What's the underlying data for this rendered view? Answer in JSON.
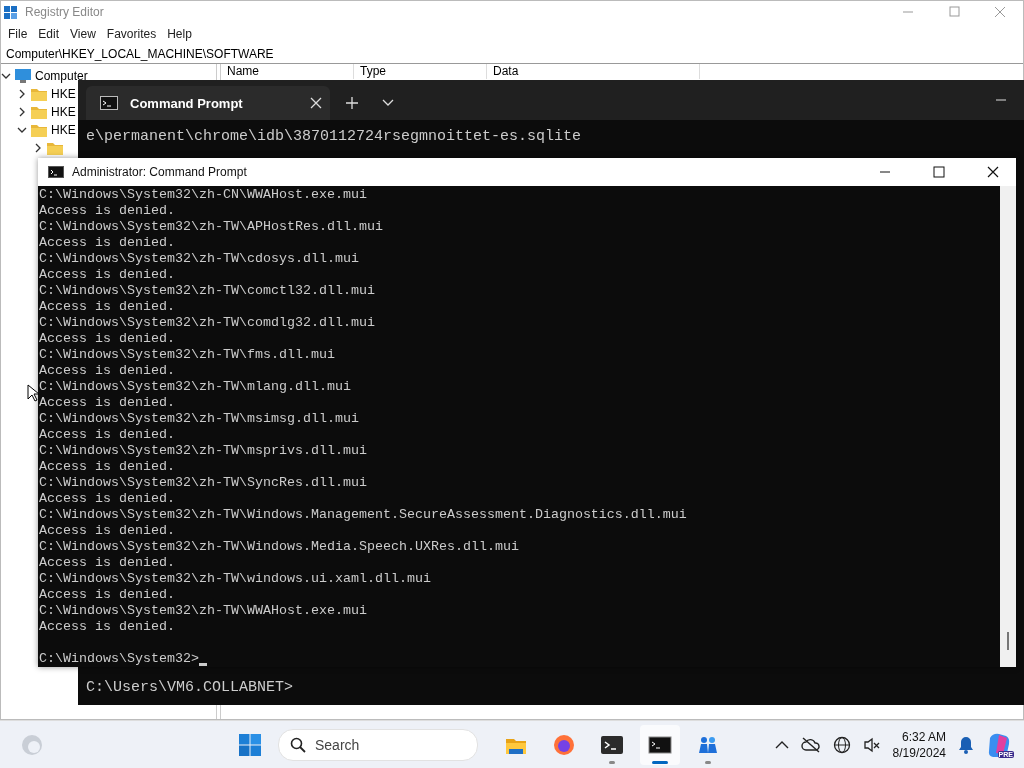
{
  "registry_editor": {
    "title": "Registry Editor",
    "menu": [
      "File",
      "Edit",
      "View",
      "Favorites",
      "Help"
    ],
    "address": "Computer\\HKEY_LOCAL_MACHINE\\SOFTWARE",
    "tree": [
      {
        "label": "Computer",
        "expanded": true,
        "children": [
          {
            "label": "HKE",
            "expanded": false
          },
          {
            "label": "HKE",
            "expanded": false
          },
          {
            "label": "HKE",
            "expanded": true,
            "children": [
              {
                "expanded": false
              }
            ]
          }
        ]
      }
    ],
    "columns": [
      "Name",
      "Type",
      "Data"
    ]
  },
  "terminal": {
    "tabs": [
      {
        "label": "Command Prompt",
        "selected": true
      }
    ],
    "lines": [
      "e\\permanent\\chrome\\idb\\3870112724rsegmnoittet-es.sqlite"
    ],
    "prompt": "C:\\Users\\VM6.COLLABNET>"
  },
  "admin_prompt": {
    "title": "Administrator: Command Prompt",
    "lines": [
      "C:\\Windows\\System32\\zh-CN\\WWAHost.exe.mui",
      "Access is denied.",
      "C:\\Windows\\System32\\zh-TW\\APHostRes.dll.mui",
      "Access is denied.",
      "C:\\Windows\\System32\\zh-TW\\cdosys.dll.mui",
      "Access is denied.",
      "C:\\Windows\\System32\\zh-TW\\comctl32.dll.mui",
      "Access is denied.",
      "C:\\Windows\\System32\\zh-TW\\comdlg32.dll.mui",
      "Access is denied.",
      "C:\\Windows\\System32\\zh-TW\\fms.dll.mui",
      "Access is denied.",
      "C:\\Windows\\System32\\zh-TW\\mlang.dll.mui",
      "Access is denied.",
      "C:\\Windows\\System32\\zh-TW\\msimsg.dll.mui",
      "Access is denied.",
      "C:\\Windows\\System32\\zh-TW\\msprivs.dll.mui",
      "Access is denied.",
      "C:\\Windows\\System32\\zh-TW\\SyncRes.dll.mui",
      "Access is denied.",
      "C:\\Windows\\System32\\zh-TW\\Windows.Management.SecureAssessment.Diagnostics.dll.mui",
      "Access is denied.",
      "C:\\Windows\\System32\\zh-TW\\Windows.Media.Speech.UXRes.dll.mui",
      "Access is denied.",
      "C:\\Windows\\System32\\zh-TW\\windows.ui.xaml.dll.mui",
      "Access is denied.",
      "C:\\Windows\\System32\\zh-TW\\WWAHost.exe.mui",
      "Access is denied."
    ],
    "prompt": "C:\\Windows\\System32>"
  },
  "taskbar": {
    "search": {
      "placeholder": "Search"
    },
    "apps": [
      {
        "kind": "files",
        "running": false,
        "active": false
      },
      {
        "kind": "browser",
        "running": false,
        "active": false
      },
      {
        "kind": "terminal",
        "running": true,
        "active": false
      },
      {
        "kind": "cmd",
        "running": true,
        "active": true
      },
      {
        "kind": "people",
        "running": true,
        "active": false
      }
    ],
    "copilot_badge": "PRE",
    "time": "6:32 AM",
    "date": "8/19/2024"
  }
}
